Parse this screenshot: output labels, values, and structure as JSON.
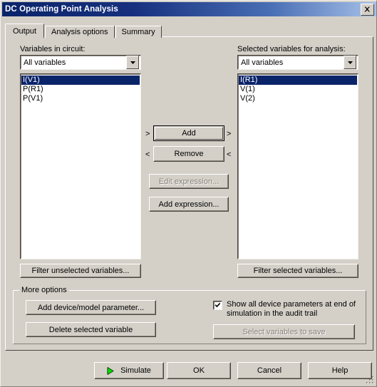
{
  "window": {
    "title": "DC Operating Point Analysis",
    "close_icon": "close-icon"
  },
  "tabs": [
    {
      "label": "Output",
      "active": true
    },
    {
      "label": "Analysis options",
      "active": false
    },
    {
      "label": "Summary",
      "active": false
    }
  ],
  "left_panel": {
    "label": "Variables in circuit:",
    "filter_value": "All variables",
    "items": [
      {
        "label": "I(V1)",
        "selected": true
      },
      {
        "label": "P(R1)",
        "selected": false
      },
      {
        "label": "P(V1)",
        "selected": false
      }
    ],
    "filter_button": "Filter unselected variables..."
  },
  "right_panel": {
    "label": "Selected variables for analysis:",
    "filter_value": "All variables",
    "items": [
      {
        "label": "I(R1)",
        "selected": true
      },
      {
        "label": "V(1)",
        "selected": false
      },
      {
        "label": "V(2)",
        "selected": false
      }
    ],
    "filter_button": "Filter selected variables..."
  },
  "transfer": {
    "add_label": "Add",
    "remove_label": "Remove",
    "edit_expression_label": "Edit expression...",
    "add_expression_label": "Add expression...",
    "add_hint_left": ">",
    "add_hint_right": ">",
    "remove_hint_left": "<",
    "remove_hint_right": "<"
  },
  "more_options": {
    "title": "More options",
    "add_device_label": "Add device/model parameter...",
    "delete_variable_label": "Delete selected variable",
    "show_all_params_label": "Show all device parameters at end of simulation in the audit trail",
    "show_all_params_checked": true,
    "select_variables_label": "Select variables to save"
  },
  "footer": {
    "simulate_label": "Simulate",
    "ok_label": "OK",
    "cancel_label": "Cancel",
    "help_label": "Help",
    "simulate_icon": "play-icon"
  },
  "colors": {
    "face": "#d4d0c8",
    "title_start": "#0a246a",
    "title_end": "#a6c0e8",
    "selection": "#0a246a",
    "disabled_text": "#868078",
    "play_green": "#00e000"
  }
}
